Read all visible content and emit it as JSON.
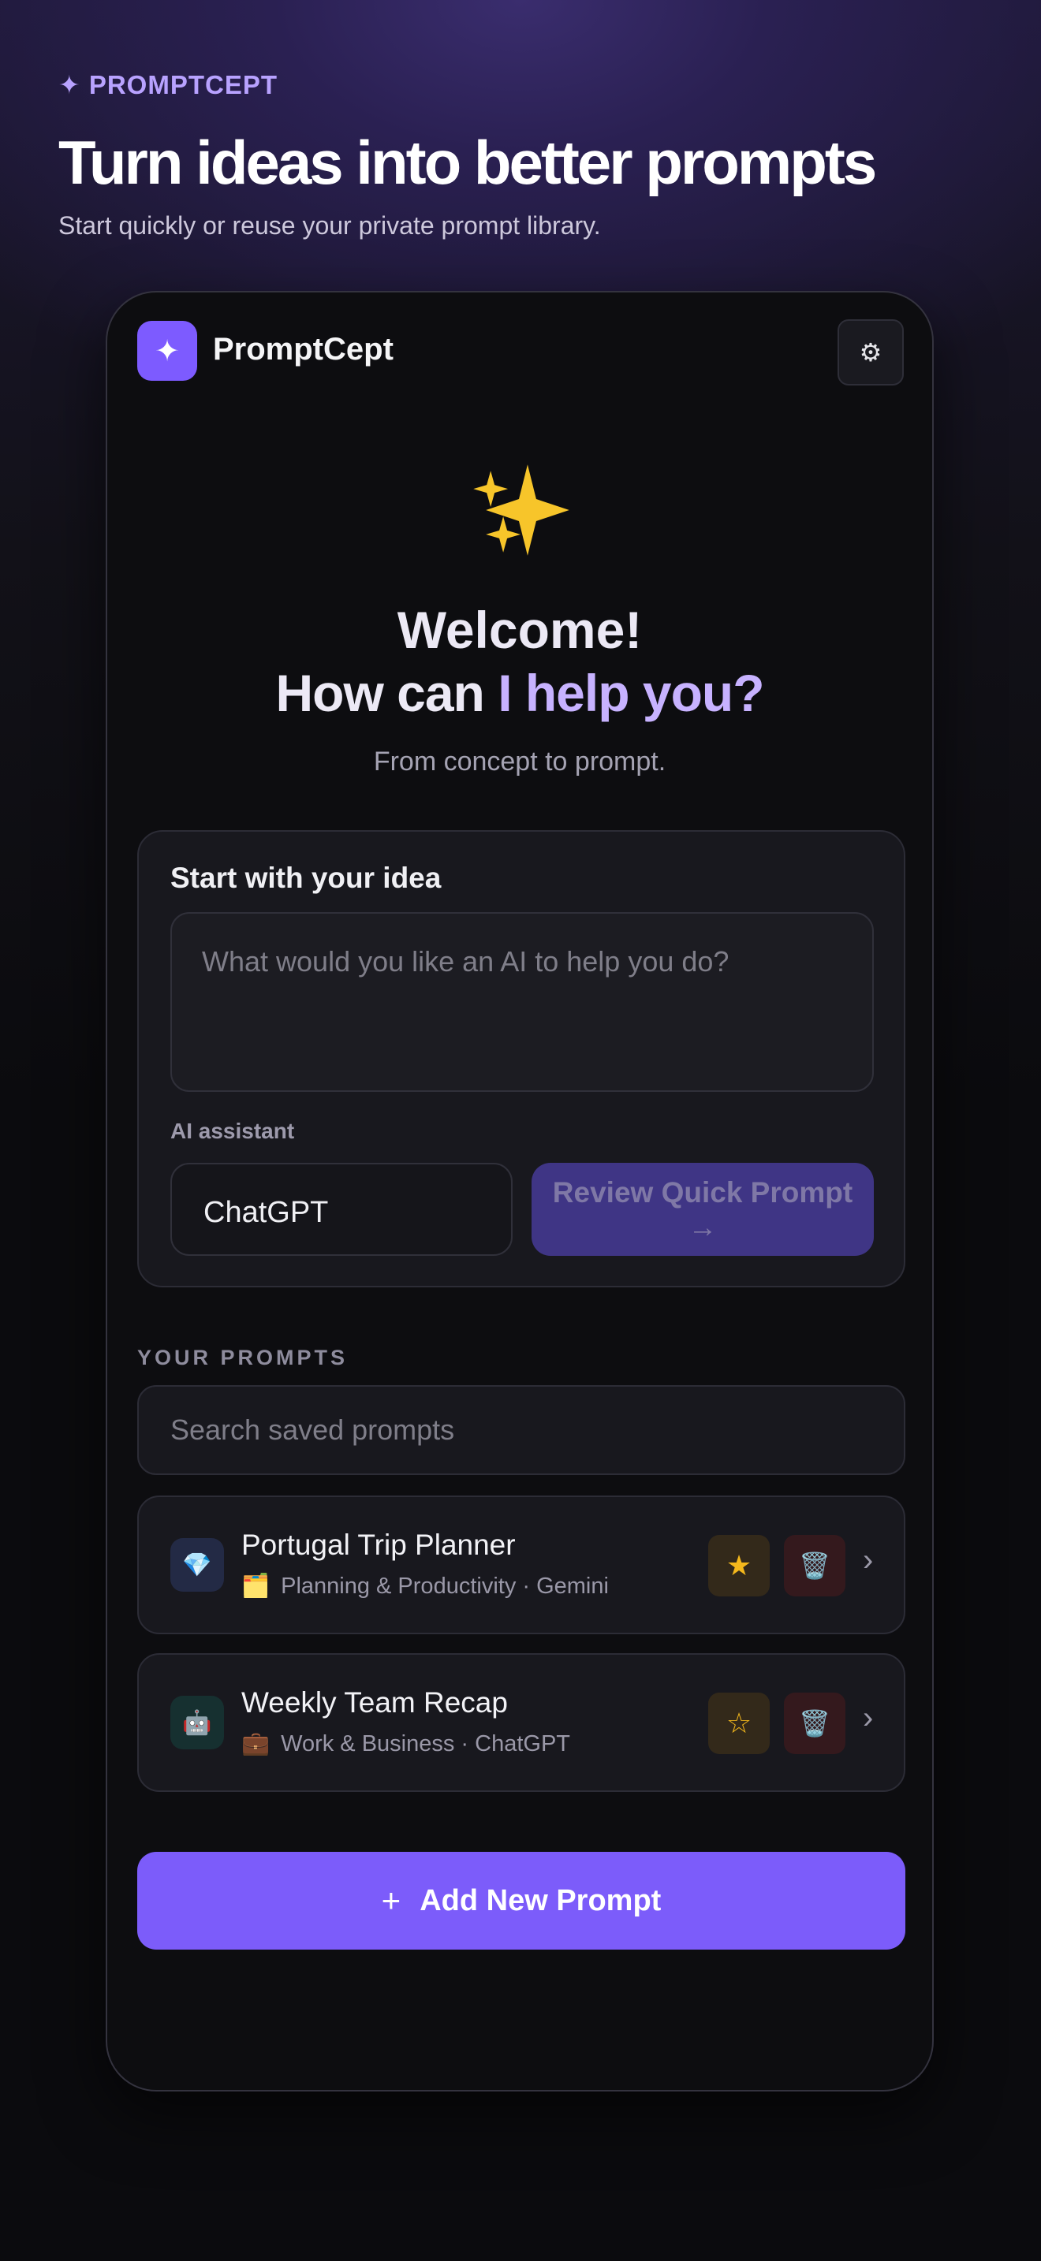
{
  "page": {
    "brand": "✦ PROMPTCEPT",
    "title": "Turn ideas into better prompts",
    "subtitle": "Start quickly or reuse your private prompt library."
  },
  "app": {
    "logo_glyph": "✦",
    "name": "PromptCept",
    "settings_icon": "⚙",
    "sparkle_icon": "sparkles-icon",
    "welcome_line1": "Welcome!",
    "welcome_line2_prefix": "How can ",
    "welcome_line2_accent": "I help you?",
    "tagline": "From concept to prompt."
  },
  "idea": {
    "title": "Start with your idea",
    "placeholder": "What would you like an AI to help you do?",
    "assistant_label": "AI assistant",
    "assistant_value": "ChatGPT",
    "review_label": "Review Quick Prompt",
    "review_arrow": "→"
  },
  "prompts": {
    "section_label": "YOUR PROMPTS",
    "search_placeholder": "Search saved prompts",
    "items": [
      {
        "icon": "💎",
        "icon_bg": "#232a45",
        "title": "Portugal Trip Planner",
        "folder_icon": "🗂️",
        "meta": "Planning & Productivity · Gemini",
        "star": "★",
        "favorited": true,
        "trash": "🗑️",
        "chevron": "›"
      },
      {
        "icon": "🤖",
        "icon_bg": "#163030",
        "title": "Weekly Team Recap",
        "folder_icon": "💼",
        "meta": "Work & Business · ChatGPT",
        "star": "☆",
        "favorited": false,
        "trash": "🗑️",
        "chevron": "›"
      }
    ],
    "add_plus": "+",
    "add_label": "Add New Prompt"
  },
  "colors": {
    "accent": "#7c5cfa",
    "accent_light": "#c7b2ff",
    "star": "#f4b81c"
  }
}
